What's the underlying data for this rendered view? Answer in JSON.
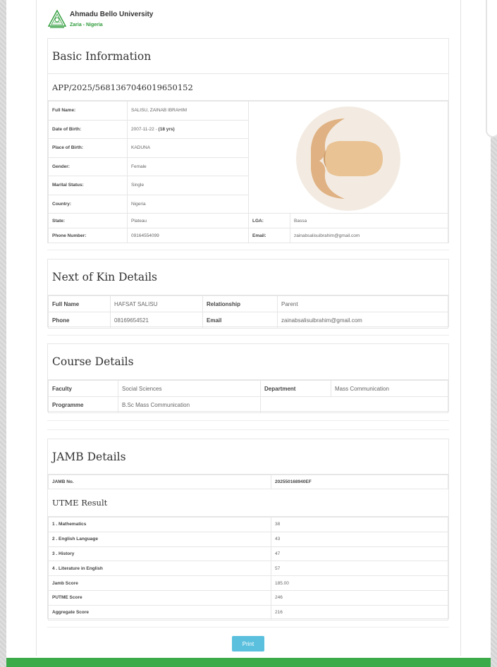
{
  "header": {
    "university": "Ahmadu Bello University",
    "location": "Zaria - Nigeria"
  },
  "basic": {
    "title": "Basic Information",
    "app_no": "APP/2025/5681367046019650152",
    "rows": [
      {
        "label": "Full Name:",
        "value": "SALISU, ZAINAB IBRAHIM"
      },
      {
        "label": "Date of Birth:",
        "value": "2007-11-22 - ",
        "extra": "(18 yrs)"
      },
      {
        "label": "Place of Birth:",
        "value": "KADUNA"
      },
      {
        "label": "Gender:",
        "value": "Female"
      },
      {
        "label": "Marital Status:",
        "value": "Single"
      },
      {
        "label": "Country:",
        "value": "Nigeria"
      }
    ],
    "state_label": "State:",
    "state_value": "Plateau",
    "lga_label": "LGA:",
    "lga_value": "Bassa",
    "phone_label": "Phone Number:",
    "phone_value": "09164554099",
    "email_label": "Email:",
    "email_value": "zainabsalisuibrahim@gmail.com"
  },
  "kin": {
    "title": "Next of Kin Details",
    "full_name_label": "Full Name",
    "full_name_value": "HAFSAT SALISU",
    "relationship_label": "Relationship",
    "relationship_value": "Parent",
    "phone_label": "Phone",
    "phone_value": "08169654521",
    "email_label": "Email",
    "email_value": "zainabsalisuibrahim@gmail.com"
  },
  "course": {
    "title": "Course Details",
    "faculty_label": "Faculty",
    "faculty_value": "Social Sciences",
    "department_label": "Department",
    "department_value": "Mass Communication",
    "programme_label": "Programme",
    "programme_value": "B.Sc Mass Communication"
  },
  "jamb": {
    "title": "JAMB Details",
    "jamb_no_label": "JAMB No.",
    "jamb_no_value": "202550168940EF",
    "utme_title": "UTME Result",
    "results": [
      {
        "label": "1 . Mathematics",
        "value": "38"
      },
      {
        "label": "2 . English Language",
        "value": "43"
      },
      {
        "label": "3 . History",
        "value": "47"
      },
      {
        "label": "4 . Literature in English",
        "value": "57"
      },
      {
        "label": "Jamb Score",
        "value": "185.00"
      },
      {
        "label": "PUTME Score",
        "value": "246"
      },
      {
        "label": "Aggregate Score",
        "value": "216"
      }
    ]
  },
  "actions": {
    "print_label": "Print"
  },
  "colors": {
    "accent_green": "#3bab4a",
    "print_button": "#5bc0de"
  },
  "icons": {
    "logo": "abu-crest-icon",
    "photo": "avatar-placeholder-icon"
  }
}
